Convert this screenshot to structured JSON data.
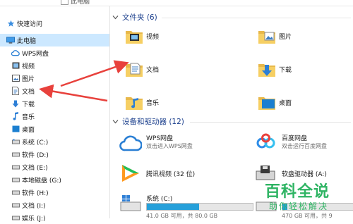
{
  "breadcrumb": {
    "text": "此电脑"
  },
  "sidebar": {
    "items": [
      {
        "label": "快速访问",
        "icon": "star-icon"
      },
      {
        "label": "此电脑",
        "icon": "computer-icon",
        "selected": true
      },
      {
        "label": "WPS网盘",
        "icon": "cloud-icon"
      },
      {
        "label": "视频",
        "icon": "video-icon"
      },
      {
        "label": "图片",
        "icon": "picture-icon"
      },
      {
        "label": "文档",
        "icon": "document-icon"
      },
      {
        "label": "下载",
        "icon": "download-arrow-icon"
      },
      {
        "label": "音乐",
        "icon": "music-note-icon"
      },
      {
        "label": "桌面",
        "icon": "desktop-icon"
      },
      {
        "label": "系统 (C:)",
        "icon": "drive-icon"
      },
      {
        "label": "软件 (D:)",
        "icon": "drive-icon"
      },
      {
        "label": "文档 (E:)",
        "icon": "drive-icon"
      },
      {
        "label": "本地磁盘 (G:)",
        "icon": "drive-icon"
      },
      {
        "label": "软件 (H:)",
        "icon": "drive-icon"
      },
      {
        "label": "文档 (I:)",
        "icon": "drive-icon"
      },
      {
        "label": "娱乐 (J:)",
        "icon": "drive-icon"
      }
    ]
  },
  "folders_group": {
    "title": "文件夹 (6)",
    "items": [
      {
        "label": "视频",
        "icon": "video-folder-icon"
      },
      {
        "label": "图片",
        "icon": "picture-folder-icon"
      },
      {
        "label": "文档",
        "icon": "document-folder-icon"
      },
      {
        "label": "下载",
        "icon": "download-folder-icon"
      },
      {
        "label": "音乐",
        "icon": "music-folder-icon"
      },
      {
        "label": "桌面",
        "icon": "desktop-folder-icon"
      }
    ]
  },
  "devices_group": {
    "title": "设备和驱动器 (12)",
    "items": [
      {
        "label": "WPS网盘",
        "sub": "双击进入WPS网盘",
        "icon": "wps-cloud-icon"
      },
      {
        "label": "百度网盘",
        "sub": "双击运行百度网盘",
        "icon": "baidu-netdisk-icon"
      },
      {
        "label": "腾讯视频 (32 位)",
        "sub": "",
        "icon": "tencent-video-icon"
      },
      {
        "label": "软盘驱动器 (A:)",
        "sub": "",
        "icon": "floppy-drive-icon"
      },
      {
        "label": "系统 (C:)",
        "sub": "41.0 GB 可用，共 80.0 GB",
        "icon": "windows-drive-icon",
        "used_fraction": 0.49
      },
      {
        "label": "",
        "sub": "470 GB 可用，共 9",
        "icon": "drive-icon",
        "used_fraction": 0.06
      }
    ]
  },
  "watermark": {
    "big": "百科全说",
    "small": "助你轻松解决"
  },
  "colors": {
    "selection": "#cce8ff",
    "group_title": "#1a3e8c",
    "progress": "#26a0da",
    "watermark": "#2eb463",
    "arrow": "#e8413c"
  }
}
